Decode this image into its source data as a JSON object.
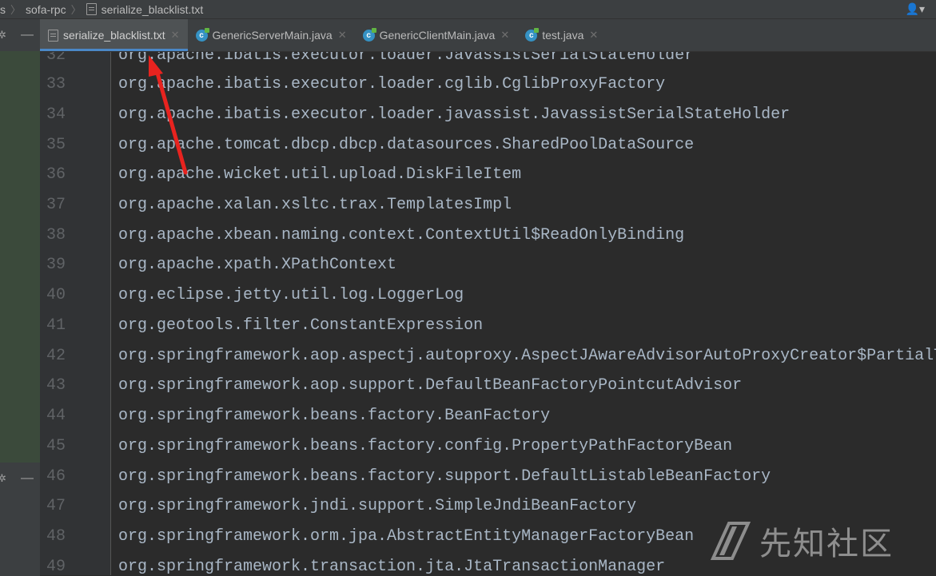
{
  "breadcrumb": {
    "project": "sofa-rpc",
    "file": "serialize_blacklist.txt",
    "partial_prefix": "s"
  },
  "user_menu_glyph": "▾",
  "tabs": [
    {
      "label": "serialize_blacklist.txt",
      "icon": "text-file-icon",
      "active": true
    },
    {
      "label": "GenericServerMain.java",
      "icon": "java-class-icon",
      "active": false
    },
    {
      "label": "GenericClientMain.java",
      "icon": "java-class-icon",
      "active": false
    },
    {
      "label": "test.java",
      "icon": "java-class-icon",
      "active": false
    }
  ],
  "editor_lines": [
    {
      "num": "32",
      "text": "org.apache.ibatis.executor.loader.JavassistSerialStateHolder"
    },
    {
      "num": "33",
      "text": "org.apache.ibatis.executor.loader.cglib.CglibProxyFactory"
    },
    {
      "num": "34",
      "text": "org.apache.ibatis.executor.loader.javassist.JavassistSerialStateHolder"
    },
    {
      "num": "35",
      "text": "org.apache.tomcat.dbcp.dbcp.datasources.SharedPoolDataSource"
    },
    {
      "num": "36",
      "text": "org.apache.wicket.util.upload.DiskFileItem"
    },
    {
      "num": "37",
      "text": "org.apache.xalan.xsltc.trax.TemplatesImpl"
    },
    {
      "num": "38",
      "text": "org.apache.xbean.naming.context.ContextUtil$ReadOnlyBinding"
    },
    {
      "num": "39",
      "text": "org.apache.xpath.XPathContext"
    },
    {
      "num": "40",
      "text": "org.eclipse.jetty.util.log.LoggerLog"
    },
    {
      "num": "41",
      "text": "org.geotools.filter.ConstantExpression"
    },
    {
      "num": "42",
      "text": "org.springframework.aop.aspectj.autoproxy.AspectJAwareAdvisorAutoProxyCreator$PartialT"
    },
    {
      "num": "43",
      "text": "org.springframework.aop.support.DefaultBeanFactoryPointcutAdvisor"
    },
    {
      "num": "44",
      "text": "org.springframework.beans.factory.BeanFactory"
    },
    {
      "num": "45",
      "text": "org.springframework.beans.factory.config.PropertyPathFactoryBean"
    },
    {
      "num": "46",
      "text": "org.springframework.beans.factory.support.DefaultListableBeanFactory"
    },
    {
      "num": "47",
      "text": "org.springframework.jndi.support.SimpleJndiBeanFactory"
    },
    {
      "num": "48",
      "text": "org.springframework.orm.jpa.AbstractEntityManagerFactoryBean"
    },
    {
      "num": "49",
      "text": "org.springframework.transaction.jta.JtaTransactionManager"
    }
  ],
  "watermark": {
    "text": "先知社区"
  },
  "colors": {
    "background": "#2b2b2b",
    "gutter": "#313335",
    "tab_bar": "#3c3f41",
    "active_tab": "#4e5254",
    "tab_underline": "#4a88c7",
    "annotation_arrow": "#e8231f"
  }
}
